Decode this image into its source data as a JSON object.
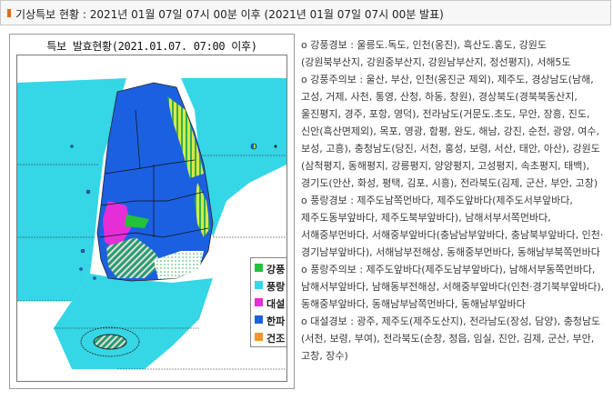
{
  "header": {
    "title": "기상특보 현황 : 2021년 01월 07일 07시 00분 이후 (2021년 01월 07일 07시 00분 발표)"
  },
  "map_panel": {
    "title": "특보 발효현황(2021.01.07. 07:00 이후)"
  },
  "legend": [
    {
      "label": "강풍",
      "color": "#22c33a"
    },
    {
      "label": "풍랑",
      "color": "#35d6e6"
    },
    {
      "label": "대설",
      "color": "#e62ed8"
    },
    {
      "label": "한파",
      "color": "#1b60e0"
    },
    {
      "label": "건조",
      "color": "#f0962a"
    }
  ],
  "warnings": [
    "o 강풍경보 : 울릉도.독도, 인천(옹진), 흑산도.홍도, 강원도(강원북부산지, 강원중부산지, 강원남부산지, 정선평지), 서해5도",
    "o 강풍주의보 : 울산, 부산, 인천(옹진군 제외), 제주도, 경상남도(남해, 고성, 거제, 사천, 통영, 산청, 하동, 창원), 경상북도(경북북동산지, 울진평지, 경주, 포항, 영덕), 전라남도(거문도.초도, 무안, 장흥, 진도, 신안(흑산면제외), 목포, 영광, 함평, 완도, 해남, 강진, 순천, 광양, 여수, 보성, 고흥), 충청남도(당진, 서천, 홍성, 보령, 서산, 태안, 아산), 강원도(삼척평지, 동해평지, 강릉평지, 양양평지, 고성평지, 속초평지, 태백), 경기도(안산, 화성, 평택, 김포, 시흥), 전라북도(김제, 군산, 부안, 고창)",
    "o 풍랑경보 : 제주도남쪽먼바다, 제주도앞바다(제주도서부앞바다, 제주도동부앞바다, 제주도북부앞바다), 남해서부서쪽먼바다, 서해중부먼바다, 서해중부앞바다(충남남부앞바다, 충남북부앞바다, 인천·경기남부앞바다), 서해남부전해상, 동해중부먼바다, 동해남부북쪽먼바다",
    "o 풍랑주의보 : 제주도앞바다(제주도남부앞바다), 남해서부동쪽먼바다, 남해서부앞바다, 남해동부전해상, 서해중부앞바다(인천·경기북부앞바다), 동해중부앞바다, 동해남부남쪽먼바다, 동해남부앞바다",
    "o 대설경보 : 광주, 제주도(제주도산지), 전라남도(장성, 담양), 충청남도(서천, 보령, 부여), 전라북도(순창, 정읍, 임실, 진안, 김제, 군산, 부안, 고창, 장수)"
  ]
}
